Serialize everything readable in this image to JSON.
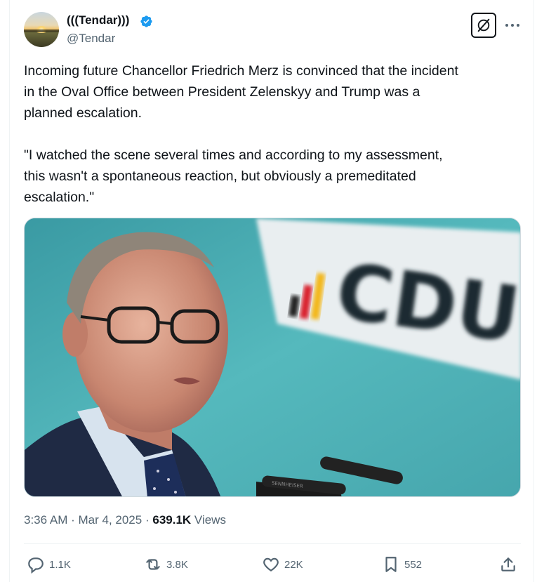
{
  "author": {
    "display_name": "(((Tendar)))",
    "handle": "@Tendar",
    "verified": true,
    "avatar": "sunset-field-avatar"
  },
  "tweet": {
    "text": "Incoming future Chancellor Friedrich Merz is convinced that the incident\nin the Oval Office between President Zelenskyy and Trump was a\nplanned escalation.\n\n\"I watched the scene several times and according to my assessment,\nthis wasn't a spontaneous reaction, but obviously a premeditated\nescalation.\"",
    "media": {
      "sign_text": "CDU",
      "mic_brand": "SENNHEISER"
    }
  },
  "meta": {
    "time": "3:36 AM",
    "date": "Mar 4, 2025",
    "views_count": "639.1K",
    "views_label": "Views"
  },
  "actions": {
    "replies": "1.1K",
    "reposts": "3.8K",
    "likes": "22K",
    "bookmarks": "552"
  },
  "icons": {
    "verified": "verified-badge-icon",
    "grok": "grok-icon",
    "more": "more-dots-icon",
    "reply": "reply-icon",
    "repost": "repost-icon",
    "like": "heart-icon",
    "bookmark": "bookmark-icon",
    "share": "share-icon"
  },
  "colors": {
    "text_primary": "#0f1419",
    "text_secondary": "#536471",
    "verified_blue": "#1d9bf0",
    "image_teal": "#4fb3b8"
  }
}
